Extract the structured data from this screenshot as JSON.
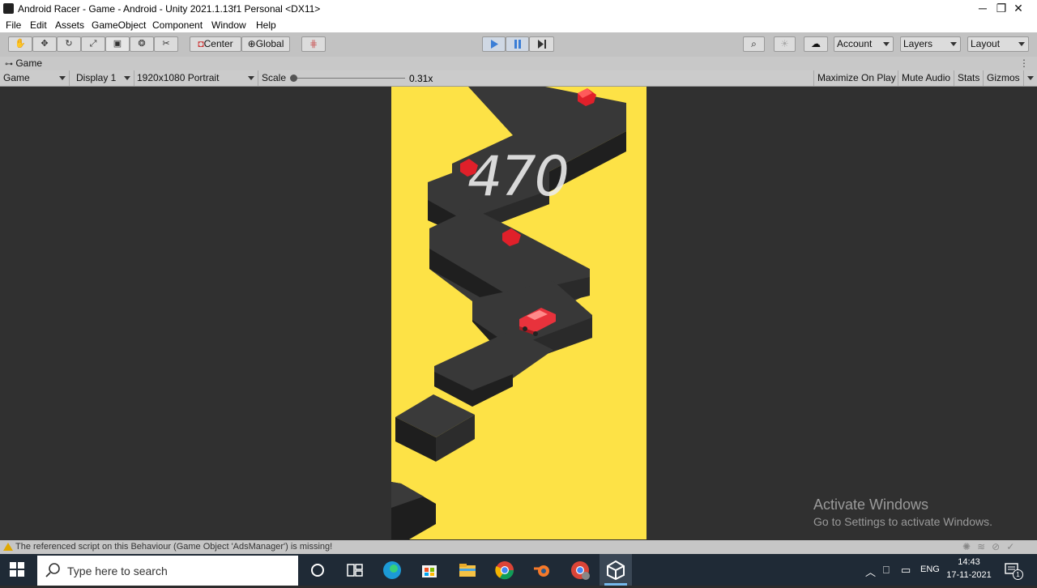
{
  "window": {
    "title": "Android Racer - Game - Android - Unity 2021.1.13f1 Personal <DX11>",
    "controls": [
      "─",
      "❐",
      "✕"
    ]
  },
  "menu": [
    "File",
    "Edit",
    "Assets",
    "GameObject",
    "Component",
    "Window",
    "Help"
  ],
  "toolbar": {
    "pivot_label": "Center",
    "space_label": "Global",
    "account_label": "Account",
    "layers_label": "Layers",
    "layout_label": "Layout"
  },
  "tab": {
    "label": "Game"
  },
  "game_toolbar": {
    "view_mode": "Game",
    "display": "Display 1",
    "resolution": "1920x1080 Portrait",
    "scale_label": "Scale",
    "scale_value": "0.31x",
    "maximize": "Maximize On Play",
    "mute": "Mute Audio",
    "stats": "Stats",
    "gizmos": "Gizmos"
  },
  "game": {
    "score": "470"
  },
  "watermark": {
    "title": "Activate Windows",
    "subtitle": "Go to Settings to activate Windows."
  },
  "status": {
    "message": "The referenced script on this Behaviour (Game Object 'AdsManager') is missing!"
  },
  "taskbar": {
    "search_placeholder": "Type here to search",
    "language": "ENG",
    "time": "14:43",
    "date": "17-11-2021",
    "notification_count": "1"
  },
  "colors": {
    "game_background": "#fde246",
    "road_top": "#383838",
    "road_side": "#1f1f1f",
    "gem": "#e0202a",
    "car": "#e8323c",
    "play_accent": "#3b7ed6"
  }
}
